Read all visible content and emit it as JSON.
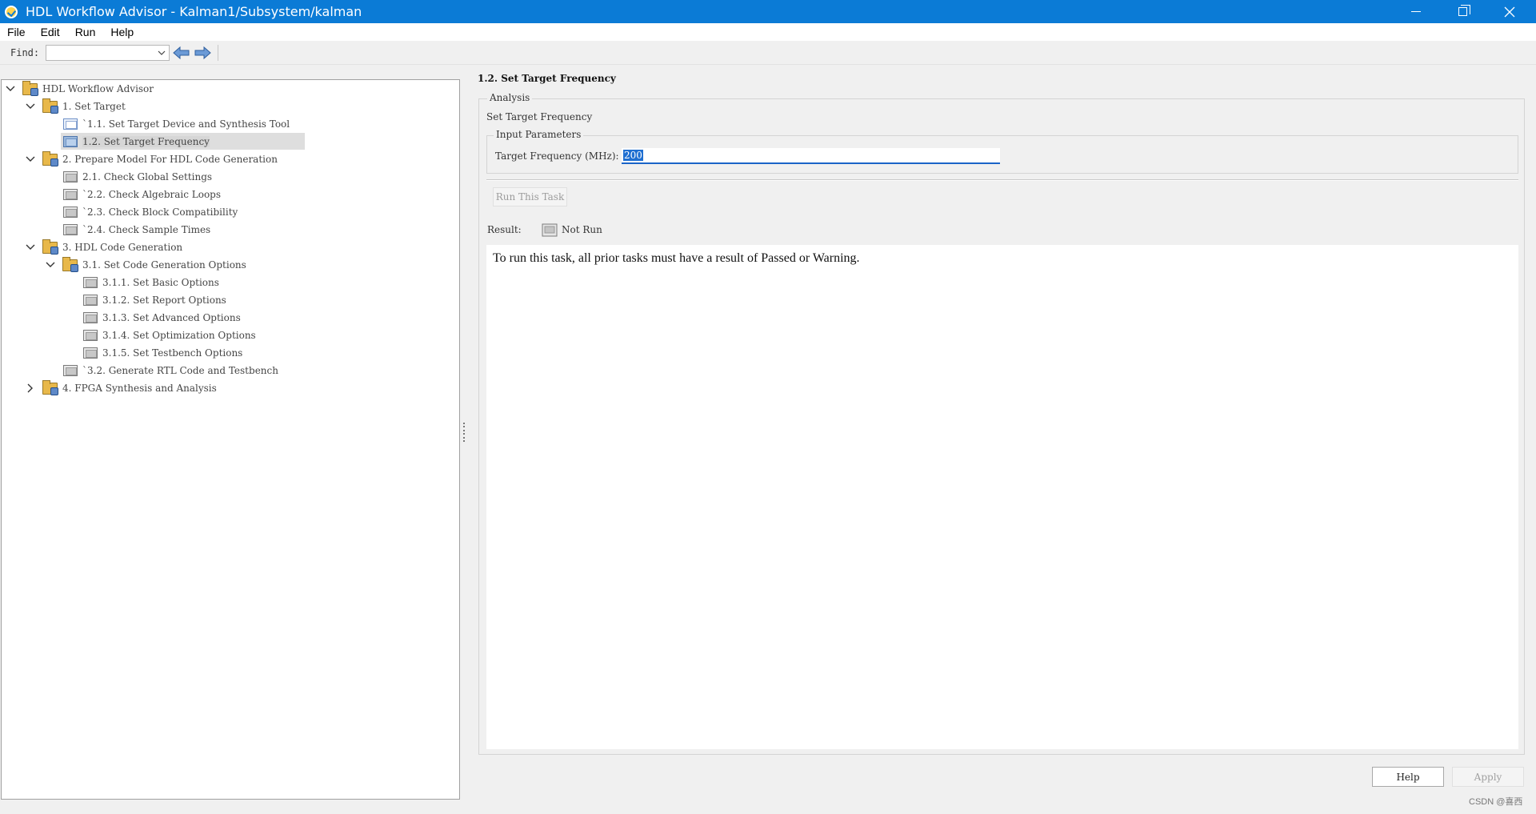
{
  "window": {
    "title": "HDL Workflow Advisor - Kalman1/Subsystem/kalman"
  },
  "menu": [
    "File",
    "Edit",
    "Run",
    "Help"
  ],
  "toolbar": {
    "find_label": "Find:",
    "find_value": ""
  },
  "tree": [
    {
      "label": "HDL Workflow Advisor",
      "level": 0,
      "icon": "folder-icon",
      "expanded": true
    },
    {
      "label": "1. Set Target",
      "level": 1,
      "icon": "folder-icon",
      "expanded": true
    },
    {
      "label": "`1.1. Set Target Device and Synthesis Tool",
      "level": 2,
      "icon": "task-doc-icon",
      "state": "active"
    },
    {
      "label": "1.2. Set Target Frequency",
      "level": 2,
      "icon": "task-doc-icon",
      "selected": true
    },
    {
      "label": "2. Prepare Model For HDL Code Generation",
      "level": 1,
      "icon": "folder-icon",
      "expanded": true
    },
    {
      "label": "2.1. Check Global Settings",
      "level": 2,
      "icon": "task-doc-icon"
    },
    {
      "label": "`2.2. Check Algebraic Loops",
      "level": 2,
      "icon": "task-doc-icon"
    },
    {
      "label": "`2.3. Check Block Compatibility",
      "level": 2,
      "icon": "task-doc-icon"
    },
    {
      "label": "`2.4. Check Sample Times",
      "level": 2,
      "icon": "task-doc-icon"
    },
    {
      "label": "3. HDL Code Generation",
      "level": 1,
      "icon": "folder-icon",
      "expanded": true
    },
    {
      "label": "3.1. Set Code Generation Options",
      "level": 2,
      "icon": "folder-icon",
      "expanded": true
    },
    {
      "label": "3.1.1. Set Basic Options",
      "level": 3,
      "icon": "task-doc-icon"
    },
    {
      "label": "3.1.2. Set Report Options",
      "level": 3,
      "icon": "task-doc-icon"
    },
    {
      "label": "3.1.3. Set Advanced Options",
      "level": 3,
      "icon": "task-doc-icon"
    },
    {
      "label": "3.1.4. Set Optimization Options",
      "level": 3,
      "icon": "task-doc-icon"
    },
    {
      "label": "3.1.5. Set Testbench Options",
      "level": 3,
      "icon": "task-doc-icon"
    },
    {
      "label": "`3.2. Generate RTL Code and Testbench",
      "level": 2,
      "icon": "task-doc-icon"
    },
    {
      "label": "4. FPGA Synthesis and Analysis",
      "level": 1,
      "icon": "folder-icon",
      "expanded": false
    }
  ],
  "panel": {
    "title": "1.2. Set Target Frequency",
    "analysis_label": "Analysis",
    "task_name": "Set Target Frequency",
    "input_params_label": "Input Parameters",
    "freq_label": "Target Frequency (MHz):",
    "freq_value": "200",
    "run_button": "Run This Task",
    "result_label": "Result:",
    "result_value": "Not Run",
    "message": "To run this task, all prior tasks must have a result of Passed or Warning."
  },
  "buttons": {
    "help": "Help",
    "apply": "Apply"
  },
  "watermark": "CSDN @喜西",
  "colors": {
    "titlebar": "#0b7bd6",
    "selection": "#1f6fd1",
    "tree_selected_bg": "#dedede"
  }
}
